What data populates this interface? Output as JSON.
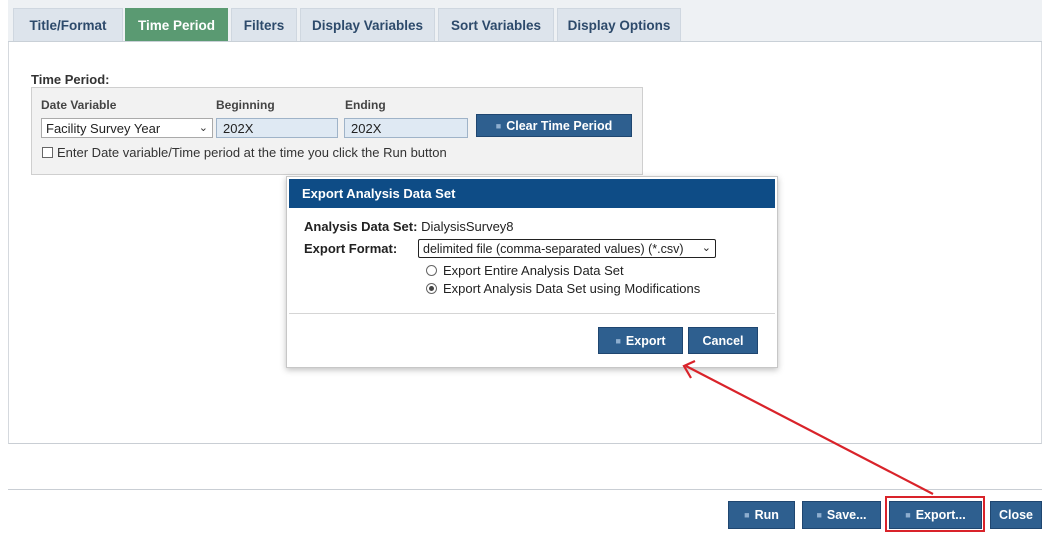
{
  "tabs": [
    {
      "label": "Title/Format",
      "active": false
    },
    {
      "label": "Time Period",
      "active": true
    },
    {
      "label": "Filters",
      "active": false
    },
    {
      "label": "Display Variables",
      "active": false
    },
    {
      "label": "Sort Variables",
      "active": false
    },
    {
      "label": "Display Options",
      "active": false
    }
  ],
  "time_period": {
    "heading": "Time Period:",
    "date_variable_label": "Date Variable",
    "beginning_label": "Beginning",
    "ending_label": "Ending",
    "date_variable_value": "Facility Survey Year",
    "beginning_value": "202X",
    "ending_value": "202X",
    "clear_button": "Clear Time Period",
    "checkbox_label": "Enter Date variable/Time period at the time you click the Run button"
  },
  "dialog": {
    "title": "Export Analysis Data Set",
    "dataset_label": "Analysis Data Set:",
    "dataset_value": "DialysisSurvey8",
    "format_label": "Export Format:",
    "format_value": "delimited file (comma-separated values) (*.csv)",
    "radio_entire": "Export Entire Analysis Data Set",
    "radio_modifications": "Export Analysis Data Set using Modifications",
    "selected_radio": "modifications",
    "export_button": "Export",
    "cancel_button": "Cancel"
  },
  "bottom_bar": {
    "run": "Run",
    "save": "Save...",
    "export": "Export...",
    "close": "Close"
  },
  "colors": {
    "active_tab": "#5a9a72",
    "button": "#2e5f8f",
    "dialog_header": "#0e4c86",
    "annotation": "#d9232a"
  }
}
